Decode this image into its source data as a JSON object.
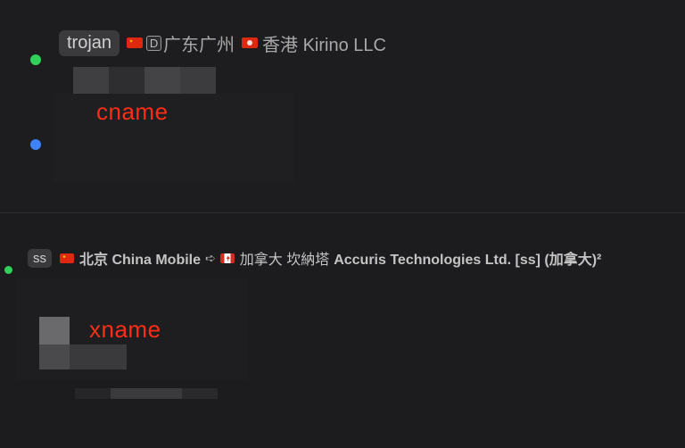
{
  "top": {
    "protocol": "trojan",
    "parts": [
      "广东广州",
      "香港 Kirino LLC"
    ],
    "d_symbol": "D",
    "red_label": "cname"
  },
  "bottom": {
    "protocol": "ss",
    "from": "北京 China Mobile",
    "arrow": "➪",
    "to_cn": "加拿大 坎納塔",
    "to_en": "Accuris Technologies Ltd. [ss] (加拿大)²",
    "red_label": "xname"
  },
  "colors": {
    "background": "#1c1c1e",
    "badge": "#3a3a3c",
    "red_label": "#ff2d18",
    "dot_green": "#30d158",
    "dot_blue": "#3e82f7"
  },
  "icons": [
    "flag-china",
    "flag-hong-kong",
    "flag-canada",
    "status-dot-green",
    "status-dot-blue",
    "circled-d-icon"
  ]
}
